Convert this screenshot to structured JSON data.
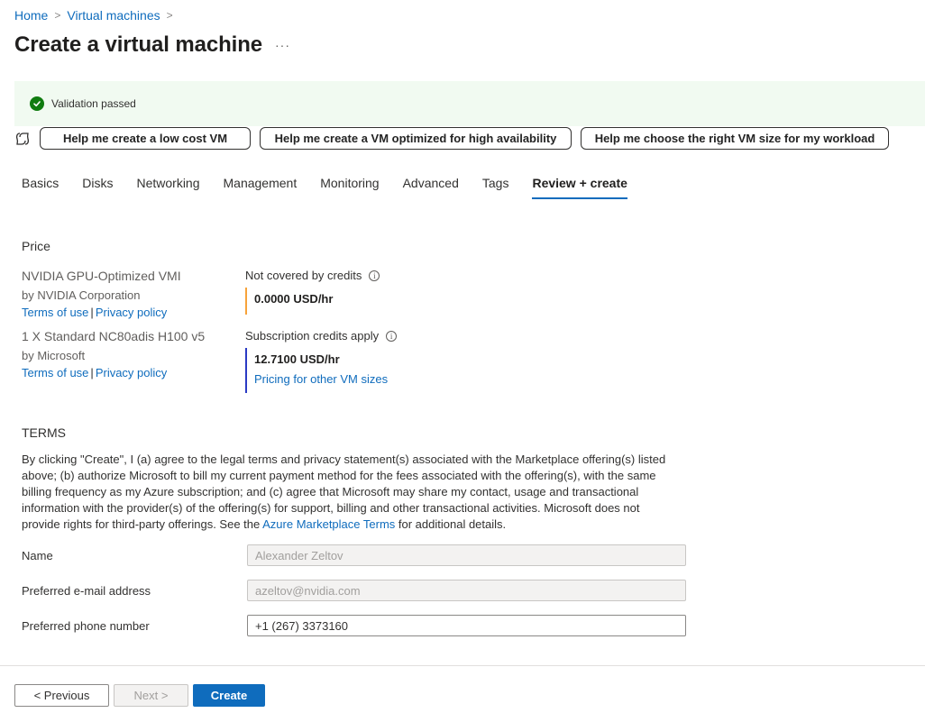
{
  "breadcrumb": {
    "items": [
      "Home",
      "Virtual machines"
    ]
  },
  "page": {
    "title": "Create a virtual machine",
    "more": "···"
  },
  "validation": {
    "message": "Validation passed"
  },
  "copilot": {
    "suggestions": [
      "Help me create a low cost VM",
      "Help me create a VM optimized for high availability",
      "Help me choose the right VM size for my workload"
    ]
  },
  "tabs": [
    "Basics",
    "Disks",
    "Networking",
    "Management",
    "Monitoring",
    "Advanced",
    "Tags",
    "Review + create"
  ],
  "active_tab": "Review + create",
  "price": {
    "title": "Price",
    "offers": [
      {
        "name": "NVIDIA GPU-Optimized VMI",
        "by": "by NVIDIA Corporation",
        "terms": "Terms of use",
        "privacy": "Privacy policy"
      },
      {
        "name": "1 X Standard NC80adis H100 v5",
        "by": "by Microsoft",
        "terms": "Terms of use",
        "privacy": "Privacy policy"
      }
    ],
    "costs": [
      {
        "label": "Not covered by credits",
        "amount": "0.0000 USD/hr",
        "color": "#f7a33a"
      },
      {
        "label": "Subscription credits apply",
        "amount": "12.7100 USD/hr",
        "link": "Pricing for other VM sizes",
        "color": "#2b3bc4"
      }
    ]
  },
  "terms": {
    "title": "TERMS",
    "text_before": "By clicking \"Create\", I (a) agree to the legal terms and privacy statement(s) associated with the Marketplace offering(s) listed above; (b) authorize Microsoft to bill my current payment method for the fees associated with the offering(s), with the same billing frequency as my Azure subscription; and (c) agree that Microsoft may share my contact, usage and transactional information with the provider(s) of the offering(s) for support, billing and other transactional activities. Microsoft does not provide rights for third-party offerings. See the ",
    "link": "Azure Marketplace Terms",
    "text_after": " for additional details."
  },
  "form": {
    "name": {
      "label": "Name",
      "value": "Alexander Zeltov"
    },
    "email": {
      "label": "Preferred e-mail address",
      "value": "azeltov@nvidia.com"
    },
    "phone": {
      "label": "Preferred phone number",
      "value": "+1 (267) 3373160"
    }
  },
  "footer": {
    "previous": "< Previous",
    "next": "Next >",
    "create": "Create"
  },
  "colors": {
    "accent": "#0f6cbd",
    "success": "#107c10",
    "validation_bg": "#f1faf1"
  }
}
